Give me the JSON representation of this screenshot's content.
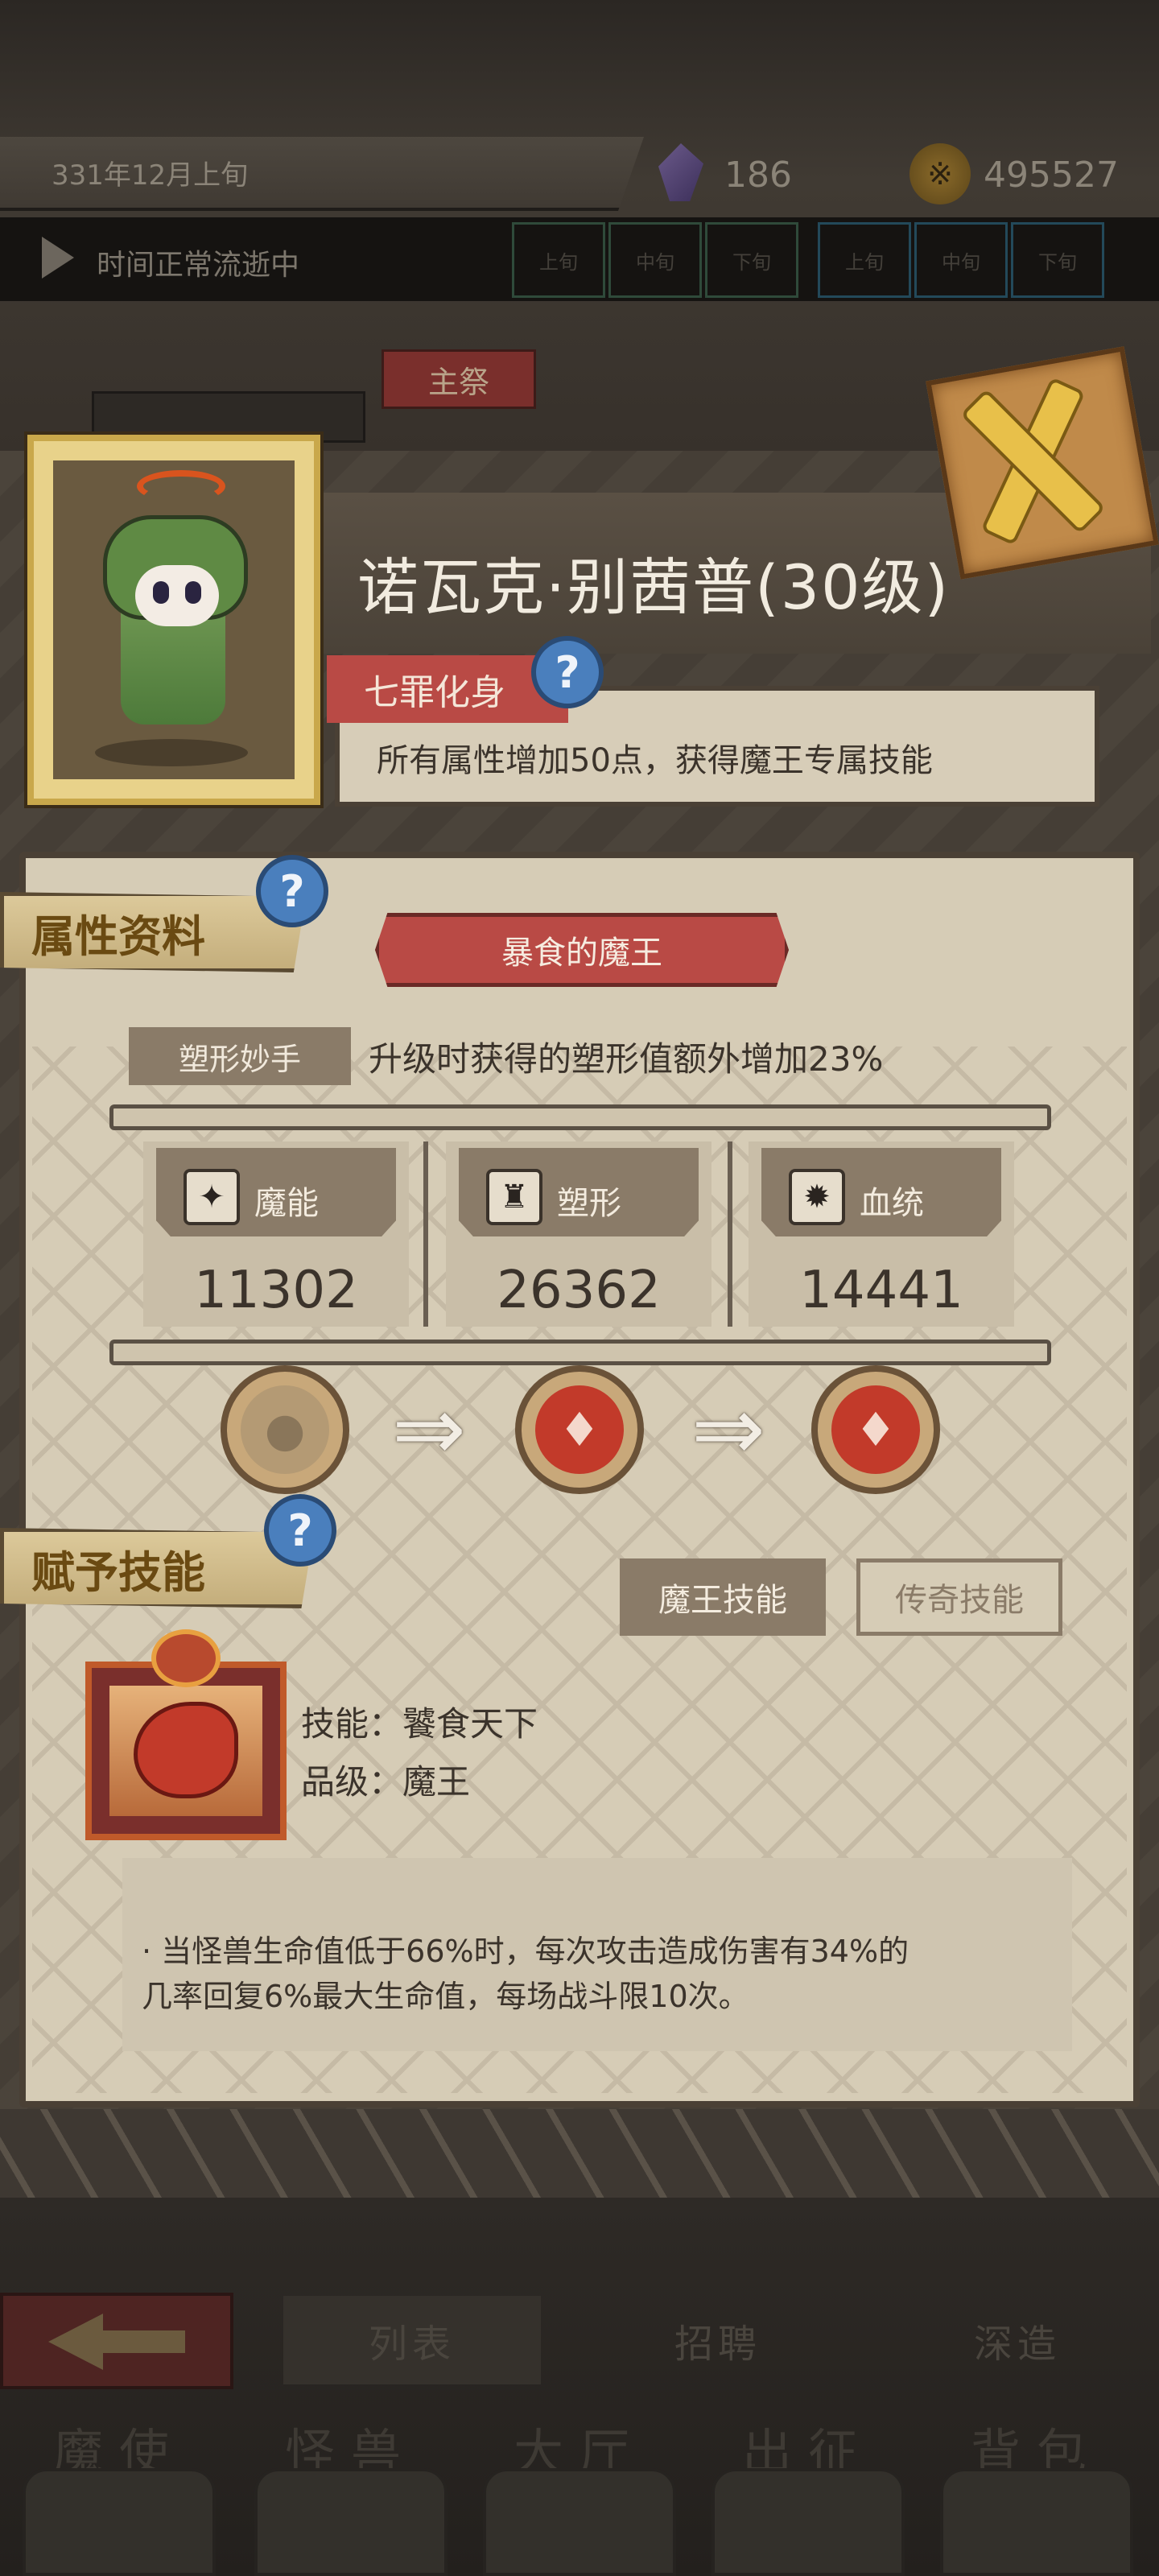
{
  "topbar": {
    "date": "331年12月上旬",
    "crystal_count": "186",
    "gold_count": "495527",
    "gold_icon_glyph": "※",
    "time_status": "时间正常流逝中",
    "time_slots": [
      "上旬",
      "中旬",
      "下旬",
      "上旬",
      "中旬",
      "下旬"
    ]
  },
  "background": {
    "tab_label": "主祭"
  },
  "character": {
    "name": "诺瓦克·别茜普(30级)",
    "title_tag": "七罪化身",
    "title_desc": "所有属性增加50点，获得魔王专属技能"
  },
  "help_glyph": "?",
  "attributes_section": {
    "label": "属性资料",
    "rank_title": "暴食的魔王",
    "trait_name": "塑形妙手",
    "trait_desc": "升级时获得的塑形值额外增加23%",
    "stats": [
      {
        "label": "魔能",
        "value": "11302",
        "icon": "flame-claw-icon"
      },
      {
        "label": "塑形",
        "value": "26362",
        "icon": "armor-icon"
      },
      {
        "label": "血统",
        "value": "14441",
        "icon": "gear-blood-icon"
      }
    ]
  },
  "skills_section": {
    "label": "赋予技能",
    "tabs": [
      "魔王技能",
      "传奇技能"
    ],
    "active_tab": "魔王技能",
    "skill_name_line": "技能：饕食天下",
    "skill_grade_line": "品级：魔王",
    "skill_desc_line1": "·  当怪兽生命值低于66%时，每次攻击造成伤害有34%的",
    "skill_desc_line2": "几率回复6%最大生命值，每场战斗限10次。"
  },
  "bottom_nav": {
    "subtabs": [
      "列表",
      "招聘",
      "深造"
    ],
    "main": [
      "魔使",
      "怪兽",
      "大厅",
      "出征",
      "背包"
    ]
  },
  "colors": {
    "accent_red": "#b94a45",
    "parchment": "#d6ccb6",
    "help_blue": "#4a7fbd",
    "text_dark": "#3b332b"
  }
}
